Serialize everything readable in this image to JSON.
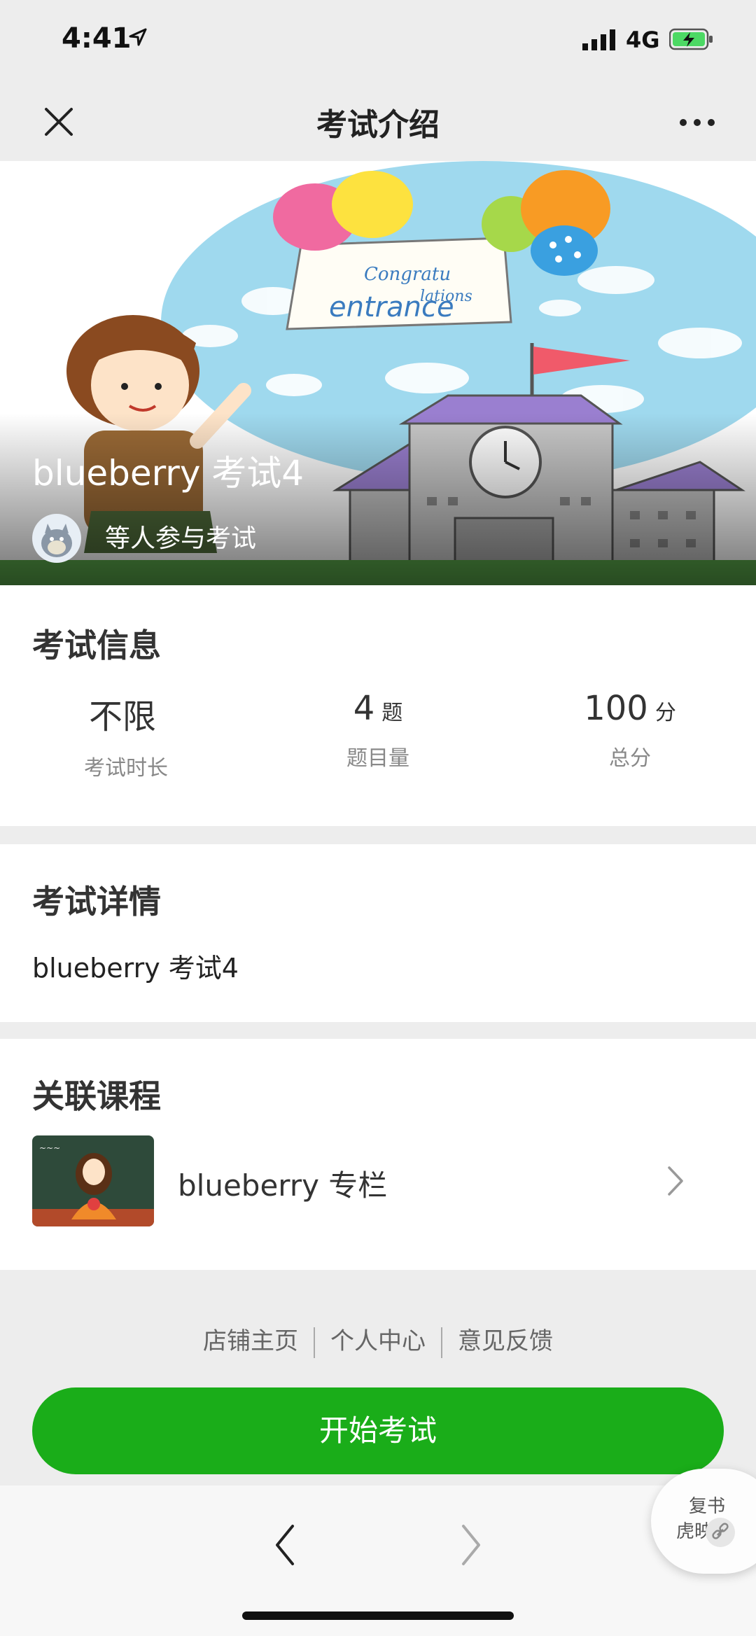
{
  "status_bar": {
    "time": "4:41",
    "network": "4G"
  },
  "nav": {
    "title": "考试介绍"
  },
  "hero": {
    "exam_title": "blueberry 考试4",
    "participants_text": "等人参与考试"
  },
  "exam_info": {
    "section_title": "考试信息",
    "stats": [
      {
        "value": "不限",
        "unit": "",
        "label": "考试时长"
      },
      {
        "value": "4",
        "unit": "题",
        "label": "题目量"
      },
      {
        "value": "100",
        "unit": "分",
        "label": "总分"
      }
    ]
  },
  "exam_details": {
    "section_title": "考试详情",
    "text": "blueberry 考试4"
  },
  "related_course": {
    "section_title": "关联课程",
    "course_name": "blueberry 专栏"
  },
  "footer": {
    "links": [
      "店铺主页",
      "个人中心",
      "意见反馈"
    ]
  },
  "action": {
    "start_label": "开始考试"
  },
  "float_widget": {
    "line1": "复书",
    "line2": "虎映"
  },
  "colors": {
    "accent": "#1aad19",
    "background": "#ededed"
  }
}
